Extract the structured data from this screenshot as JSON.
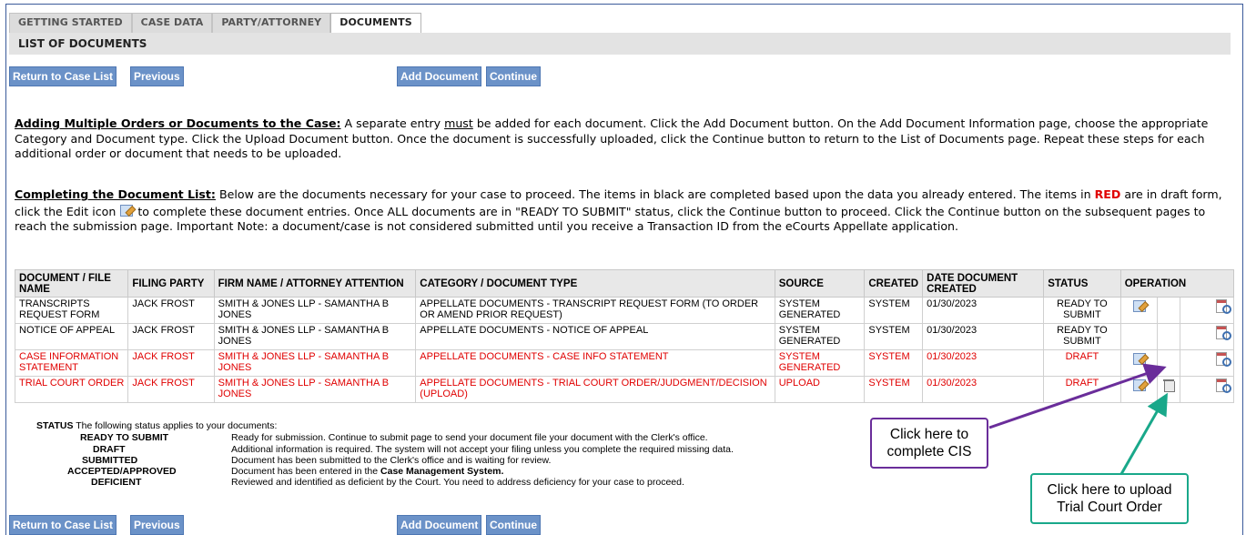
{
  "tabs": [
    "GETTING STARTED",
    "CASE DATA",
    "PARTY/ATTORNEY",
    "DOCUMENTS"
  ],
  "active_tab": "DOCUMENTS",
  "section_title": "LIST OF DOCUMENTS",
  "buttons": {
    "return_to_case_list": "Return to Case List",
    "previous": "Previous",
    "add_document": "Add Document",
    "continue": "Continue"
  },
  "instructions": {
    "multiple_orders": {
      "lead": "Adding Multiple Orders or Documents to the Case:",
      "part1": " A separate entry ",
      "must": "must",
      "part2": " be added for each document.  Click the Add Document button.  On the Add Document Information page, choose the appropriate Category and Document type.  Click the Upload Document button.  Once the document is successfully uploaded, click the Continue button to return to the List of Documents page. Repeat these steps for each additional order or document that needs to be uploaded."
    },
    "completing_list": {
      "lead": "Completing the Document List:",
      "part1": " Below are the documents necessary for your case to proceed.  The items in black are completed based upon the data you already entered.  The items in ",
      "red_word": "RED",
      "part2": " are in draft form, click the Edit icon ",
      "part3": " to complete these document entries.  Once ALL documents are in \"READY TO SUBMIT\" status, click the Continue button to proceed.  Click the Continue button on the subsequent pages to reach the submission page. Important Note: a document/case is not considered submitted until you receive a Transaction ID from the eCourts Appellate application."
    }
  },
  "table": {
    "headers": {
      "document": "DOCUMENT / FILE NAME",
      "filing_party": "FILING PARTY",
      "firm": "FIRM NAME / ATTORNEY ATTENTION",
      "category": "CATEGORY / DOCUMENT TYPE",
      "source": "SOURCE",
      "created": "CREATED",
      "date": "DATE DOCUMENT CREATED",
      "status": "STATUS",
      "operation": "OPERATION"
    },
    "rows": [
      {
        "document": "TRANSCRIPTS REQUEST FORM",
        "filing_party": "JACK FROST",
        "firm": "SMITH & JONES LLP - SAMANTHA B JONES",
        "category": "APPELLATE DOCUMENTS - TRANSCRIPT REQUEST FORM (TO ORDER OR AMEND PRIOR REQUEST)",
        "source": "SYSTEM GENERATED",
        "created": "SYSTEM",
        "date": "01/30/2023",
        "status": "READY TO SUBMIT",
        "draft": false
      },
      {
        "document": "NOTICE OF APPEAL",
        "filing_party": "JACK FROST",
        "firm": "SMITH & JONES LLP - SAMANTHA B JONES",
        "category": "APPELLATE DOCUMENTS - NOTICE OF APPEAL",
        "source": "SYSTEM GENERATED",
        "created": "SYSTEM",
        "date": "01/30/2023",
        "status": "READY TO SUBMIT",
        "draft": false
      },
      {
        "document": "CASE INFORMATION STATEMENT",
        "filing_party": "JACK FROST",
        "firm": "SMITH & JONES LLP - SAMANTHA B JONES",
        "category": "APPELLATE DOCUMENTS - CASE INFO STATEMENT",
        "source": "SYSTEM GENERATED",
        "created": "SYSTEM",
        "date": "01/30/2023",
        "status": "DRAFT",
        "draft": true
      },
      {
        "document": "TRIAL COURT ORDER",
        "filing_party": "JACK FROST",
        "firm": "SMITH & JONES LLP - SAMANTHA B JONES",
        "category": "APPELLATE DOCUMENTS - TRIAL COURT ORDER/JUDGMENT/DECISION (UPLOAD)",
        "source": "UPLOAD",
        "created": "SYSTEM",
        "date": "01/30/2023",
        "status": "DRAFT",
        "draft": true
      }
    ]
  },
  "status_legend": {
    "title": "STATUS",
    "intro": "The following status applies to your documents:",
    "items": [
      {
        "term": "READY TO SUBMIT",
        "desc": "Ready for submission. Continue to submit page to send your document file your document with the Clerk's office."
      },
      {
        "term": "DRAFT",
        "desc": "Additional information is required. The system will not accept your filing unless you complete the required missing data."
      },
      {
        "term": "SUBMITTED",
        "desc": "Document has been submitted to the Clerk's office and is waiting for review."
      },
      {
        "term": "ACCEPTED/APPROVED",
        "desc_pre": "Document has been entered in the ",
        "desc_bold": "Case Management System."
      },
      {
        "term": "DEFICIENT",
        "desc": "Reviewed and identified as deficient by the Court. You need to address deficiency for your case to proceed."
      }
    ]
  },
  "callouts": {
    "cis": "Click here to complete CIS",
    "trial": "Click here to upload Trial Court Order"
  },
  "colors": {
    "button_bg": "#6b92c8",
    "draft_text": "#e00000",
    "cis_callout_border": "#6a2d9a",
    "trial_callout_border": "#19a88a"
  },
  "icons": [
    "edit-icon",
    "delete-icon",
    "view-icon"
  ]
}
